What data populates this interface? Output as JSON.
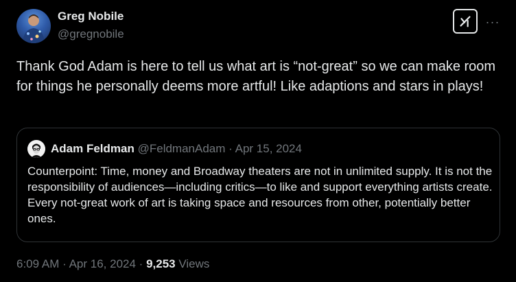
{
  "tweet": {
    "author": {
      "display_name": "Greg Nobile",
      "handle": "@gregnobile"
    },
    "text": "Thank God Adam is here to tell us what art is “not-great” so we can make room for things he personally deems more artful! Like adaptions and stars in plays!",
    "grok_icon": "grok-icon",
    "more_icon": "more-horizontal-icon",
    "more_label": "···",
    "time": "6:09 AM",
    "separator": "·",
    "date": "Apr 16, 2024",
    "views_count": "9,253",
    "views_label": "Views"
  },
  "quoted_tweet": {
    "display_name": "Adam Feldman",
    "handle": "@FeldmanAdam",
    "separator": "·",
    "date": "Apr 15, 2024",
    "text": "Counterpoint: Time, money and Broadway theaters are not in unlimited supply. It is not the responsibility of audiences—including critics—to like and support everything artists create. Every not-great work of art is taking space and resources from other, potentially better ones."
  },
  "colors": {
    "background": "#000000",
    "primary_text": "#e7e9ea",
    "secondary_text": "#71767b",
    "border": "#2f3336"
  }
}
